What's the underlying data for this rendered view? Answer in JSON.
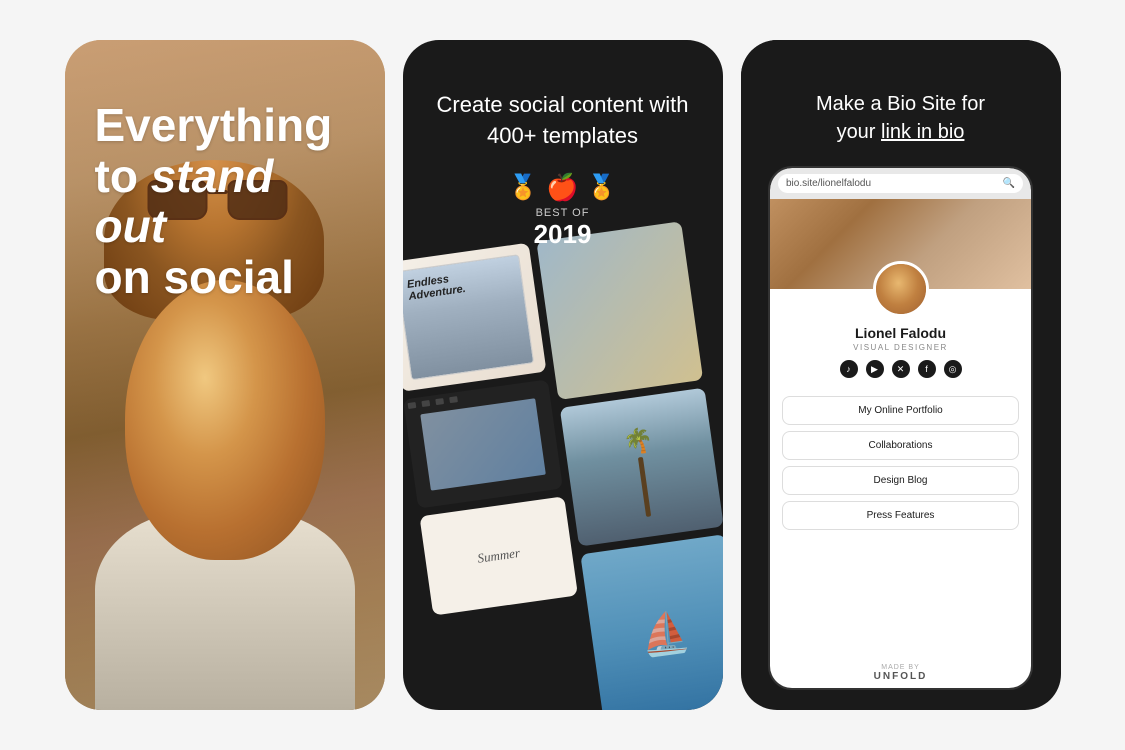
{
  "panel1": {
    "heading_line1": "Everything",
    "heading_line2": "to stand out",
    "heading_line3": "on social"
  },
  "panel2": {
    "title": "Create social content with 400+ templates",
    "award_prefix": "BEST OF",
    "award_year": "2019"
  },
  "panel3": {
    "title_line1": "Make a Bio Site for",
    "title_line2": "your link in bio",
    "url": "bio.site/lionelfalodu",
    "profile": {
      "name": "Lionel Falodu",
      "title": "VISUAL DESIGNER",
      "social_icons": [
        "♪",
        "▶",
        "𝕏",
        "f",
        "◎"
      ]
    },
    "links": [
      "My Online Portfolio",
      "Collaborations",
      "Design Blog",
      "Press Features"
    ],
    "made_by": "MADE BY",
    "brand": "UNFOLD"
  }
}
